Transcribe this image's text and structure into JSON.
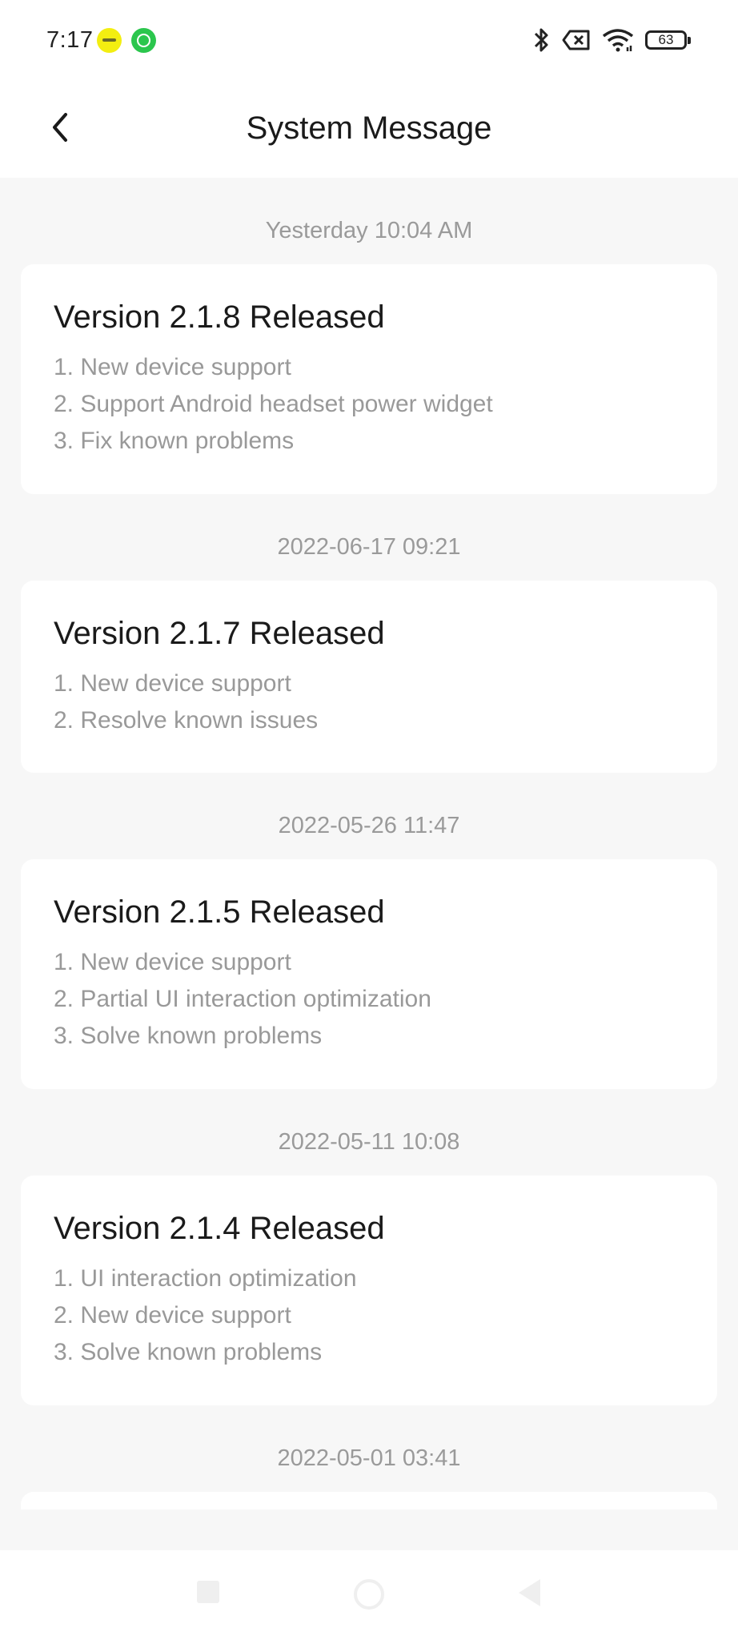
{
  "status_bar": {
    "time": "7:17",
    "battery_level": "63",
    "icons": [
      "notification-app-icon",
      "whatsapp-icon",
      "bluetooth-icon",
      "no-sim-icon",
      "wifi-icon",
      "battery-icon"
    ]
  },
  "header": {
    "title": "System Message",
    "back_icon": "chevron-left-icon"
  },
  "messages": [
    {
      "time": "Yesterday  10:04 AM",
      "title": "Version 2.1.8 Released",
      "lines": [
        "1. New device support",
        "2. Support Android headset power widget",
        "3. Fix known problems"
      ]
    },
    {
      "time": "2022-06-17 09:21",
      "title": "Version 2.1.7 Released",
      "lines": [
        "1. New device support",
        "2. Resolve known issues"
      ]
    },
    {
      "time": "2022-05-26 11:47",
      "title": "Version 2.1.5 Released",
      "lines": [
        "1. New device support",
        "2. Partial UI interaction optimization",
        "3. Solve known problems"
      ]
    },
    {
      "time": "2022-05-11 10:08",
      "title": "Version 2.1.4 Released",
      "lines": [
        "1. UI interaction optimization",
        "2. New device support",
        "3. Solve known problems"
      ]
    },
    {
      "time": "2022-05-01 03:41",
      "title": "",
      "lines": []
    }
  ],
  "nav_bar": {
    "icons": [
      "recent-apps-icon",
      "home-icon",
      "back-triangle-icon"
    ]
  }
}
